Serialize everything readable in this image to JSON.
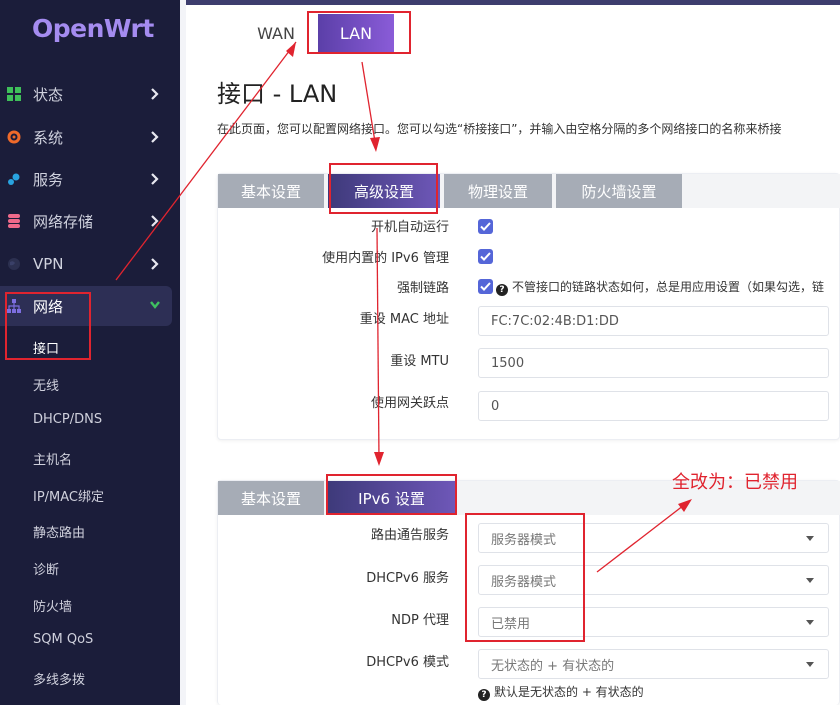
{
  "brand": {
    "logo": "OpenWrt"
  },
  "sidebar": {
    "main": [
      {
        "label": "状态"
      },
      {
        "label": "系统"
      },
      {
        "label": "服务"
      },
      {
        "label": "网络存储"
      },
      {
        "label": "VPN"
      },
      {
        "label": "网络"
      }
    ],
    "sub": [
      {
        "label": "接口"
      },
      {
        "label": "无线"
      },
      {
        "label": "DHCP/DNS"
      },
      {
        "label": "主机名"
      },
      {
        "label": "IP/MAC绑定"
      },
      {
        "label": "静态路由"
      },
      {
        "label": "诊断"
      },
      {
        "label": "防火墙"
      },
      {
        "label": "SQM QoS"
      },
      {
        "label": "多线多拨"
      }
    ]
  },
  "top_tabs": [
    {
      "label": "WAN"
    },
    {
      "label": "LAN"
    }
  ],
  "page": {
    "title": "接口 - LAN",
    "description": "在此页面，您可以配置网络接口。您可以勾选“桥接接口”，并输入由空格分隔的多个网络接口的名称来桥接"
  },
  "section1": {
    "tabs": [
      {
        "label": "基本设置"
      },
      {
        "label": "高级设置"
      },
      {
        "label": "物理设置"
      },
      {
        "label": "防火墙设置"
      }
    ],
    "rows": {
      "autostart": {
        "label": "开机自动运行",
        "checked": true
      },
      "ipv6mgmt": {
        "label": "使用内置的 IPv6 管理",
        "checked": true
      },
      "forcelink": {
        "label": "强制链路",
        "checked": true,
        "help": "不管接口的链路状态如何，总是用应用设置（如果勾选，链"
      },
      "macaddr": {
        "label": "重设 MAC 地址",
        "value": "FC:7C:02:4B:D1:DD"
      },
      "mtu": {
        "label": "重设 MTU",
        "value": "1500"
      },
      "metric": {
        "label": "使用网关跃点",
        "value": "0"
      }
    }
  },
  "section2": {
    "tabs": [
      {
        "label": "基本设置"
      },
      {
        "label": "IPv6 设置"
      }
    ],
    "rows": {
      "ra": {
        "label": "路由通告服务",
        "value": "服务器模式"
      },
      "dhcpv6": {
        "label": "DHCPv6 服务",
        "value": "服务器模式"
      },
      "ndp": {
        "label": "NDP 代理",
        "value": "已禁用"
      },
      "dhcpv6mode": {
        "label": "DHCPv6 模式",
        "value": "无状态的 + 有状态的",
        "help": "默认是无状态的 + 有状态的"
      }
    }
  },
  "annotation": {
    "text": "全改为：已禁用",
    "color": "#e0242f"
  },
  "colors": {
    "sidebar_bg": "#1b1d3a",
    "accent": "#6e57b8",
    "checkbox": "#5566d8",
    "inactive_tab": "#a6acb6"
  }
}
